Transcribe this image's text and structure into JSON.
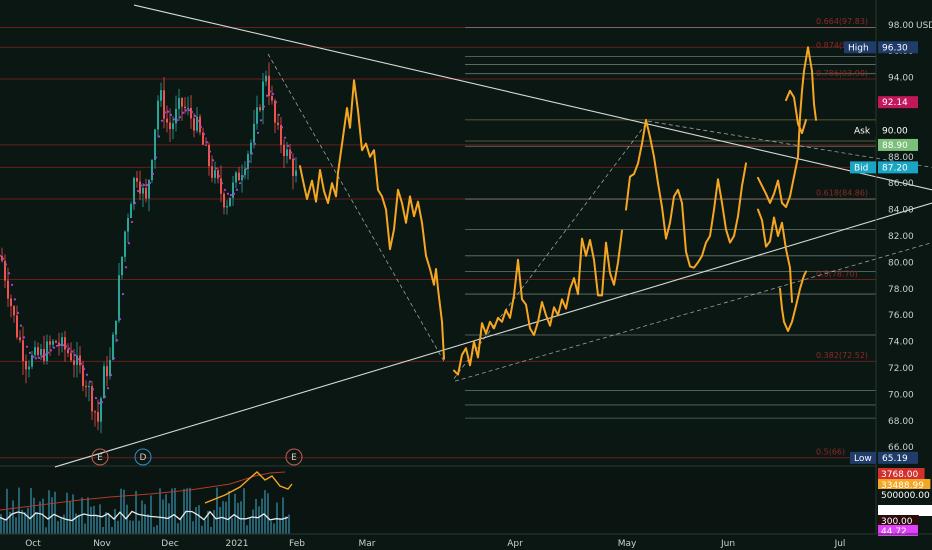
{
  "chart_data": {
    "type": "line",
    "currency": "USD",
    "y_axis_ticks": [
      98,
      96,
      94,
      92,
      90,
      88,
      86,
      84,
      82,
      80,
      78,
      76,
      74,
      72,
      70,
      68,
      66
    ],
    "x_axis_ticks": [
      "Oct",
      "Nov",
      "Dec",
      "2021",
      "Feb",
      "Mar",
      "Apr",
      "May",
      "Jun",
      "Jul"
    ],
    "ylim": [
      64.8,
      99.2
    ],
    "price_tags": [
      {
        "label": "High",
        "value": "96.30",
        "color": "#1f3c6b"
      },
      {
        "label": "",
        "value": "92.14",
        "color": "#c2185b"
      },
      {
        "label": "Ask",
        "value": "90.00",
        "color": "#0b1712"
      },
      {
        "label": "",
        "value": "88.90",
        "color": "#7bbf7b"
      },
      {
        "label": "Bid",
        "value": "87.20",
        "color": "#1aa5c4"
      },
      {
        "label": "Low",
        "value": "65.19",
        "color": "#1f3c6b"
      }
    ],
    "fib_labels": [
      {
        "text": "0.664(97.83)",
        "price": 97.83
      },
      {
        "text": "0.874(95.72)",
        "price": 96.0
      },
      {
        "text": "0.786(93.90)",
        "price": 93.9
      },
      {
        "text": "0.618(84.86)",
        "price": 84.86
      },
      {
        "text": "0.5(78.70)",
        "price": 78.7
      },
      {
        "text": "0.382(72.52)",
        "price": 72.52
      },
      {
        "text": "0.5(66)",
        "price": 65.2
      }
    ],
    "horizontal_levels": [
      97.8,
      96.3,
      93.9,
      88.9,
      87.2,
      84.8,
      78.7,
      72.5,
      65.2
    ],
    "projection_segments": [
      [
        [
          300,
          87.3
        ],
        [
          303,
          86.2
        ],
        [
          307,
          84.8
        ],
        [
          312,
          86.2
        ],
        [
          316,
          84.6
        ],
        [
          320,
          87.0
        ],
        [
          324,
          85.4
        ],
        [
          328,
          84.5
        ],
        [
          332,
          86.0
        ],
        [
          336,
          85.0
        ],
        [
          338,
          86.8
        ],
        [
          343,
          89.5
        ],
        [
          347,
          91.7
        ],
        [
          350,
          90.2
        ],
        [
          354,
          93.8
        ],
        [
          358,
          91.5
        ],
        [
          362,
          88.5
        ],
        [
          366,
          89.0
        ],
        [
          370,
          88.0
        ],
        [
          374,
          88.5
        ],
        [
          378,
          85.5
        ],
        [
          382,
          85.0
        ],
        [
          386,
          84.0
        ],
        [
          390,
          81.0
        ],
        [
          394,
          82.5
        ],
        [
          398,
          85.5
        ],
        [
          402,
          84.5
        ],
        [
          406,
          83.0
        ],
        [
          410,
          85.0
        ],
        [
          414,
          83.5
        ],
        [
          418,
          84.6
        ],
        [
          422,
          83.0
        ],
        [
          426,
          80.5
        ],
        [
          430,
          79.5
        ],
        [
          434,
          78.3
        ],
        [
          436,
          79.5
        ],
        [
          438,
          78.0
        ],
        [
          442,
          75.5
        ],
        [
          444,
          72.7
        ]
      ],
      [
        [
          454,
          71.8
        ],
        [
          458,
          71.5
        ],
        [
          462,
          73.0
        ],
        [
          466,
          73.5
        ],
        [
          470,
          72.2
        ],
        [
          474,
          74.0
        ],
        [
          478,
          72.8
        ],
        [
          482,
          75.4
        ],
        [
          486,
          74.6
        ],
        [
          490,
          75.5
        ],
        [
          494,
          75.0
        ],
        [
          498,
          75.8
        ],
        [
          502,
          75.5
        ],
        [
          506,
          76.4
        ],
        [
          510,
          75.8
        ],
        [
          514,
          77.5
        ],
        [
          518,
          80.2
        ],
        [
          522,
          77.2
        ],
        [
          526,
          76.8
        ],
        [
          530,
          75.0
        ],
        [
          534,
          74.5
        ],
        [
          538,
          75.5
        ],
        [
          542,
          77.0
        ],
        [
          546,
          76.0
        ],
        [
          550,
          75.2
        ],
        [
          554,
          76.6
        ],
        [
          558,
          76.0
        ],
        [
          562,
          77.2
        ],
        [
          566,
          76.5
        ],
        [
          570,
          78.0
        ],
        [
          574,
          78.8
        ],
        [
          578,
          77.6
        ],
        [
          582,
          81.8
        ],
        [
          586,
          80.5
        ],
        [
          590,
          81.7
        ],
        [
          594,
          80.2
        ],
        [
          598,
          77.5
        ],
        [
          602,
          77.5
        ],
        [
          606,
          81.5
        ],
        [
          610,
          79.2
        ],
        [
          614,
          78.3
        ],
        [
          618,
          80.0
        ],
        [
          622,
          82.4
        ]
      ],
      [
        [
          626,
          84.0
        ],
        [
          630,
          86.5
        ],
        [
          634,
          86.7
        ],
        [
          638,
          87.5
        ],
        [
          642,
          89.0
        ],
        [
          646,
          90.8
        ],
        [
          650,
          89.5
        ],
        [
          654,
          88.0
        ],
        [
          658,
          86.0
        ],
        [
          662,
          84.2
        ],
        [
          666,
          81.8
        ],
        [
          670,
          83.0
        ],
        [
          674,
          85.0
        ],
        [
          678,
          85.5
        ],
        [
          682,
          84.5
        ],
        [
          686,
          80.8
        ],
        [
          690,
          79.7
        ],
        [
          694,
          79.6
        ],
        [
          698,
          80.0
        ],
        [
          702,
          80.5
        ],
        [
          706,
          81.5
        ],
        [
          710,
          82.0
        ],
        [
          714,
          84.0
        ],
        [
          718,
          86.3
        ],
        [
          722,
          84.5
        ],
        [
          726,
          82.5
        ],
        [
          730,
          81.5
        ],
        [
          734,
          82.0
        ],
        [
          738,
          83.5
        ],
        [
          742,
          85.8
        ],
        [
          746,
          87.5
        ]
      ],
      [
        [
          758,
          84.0
        ],
        [
          762,
          83.2
        ],
        [
          766,
          81.2
        ],
        [
          770,
          81.6
        ],
        [
          774,
          83.4
        ],
        [
          778,
          82.0
        ],
        [
          782,
          83.0
        ],
        [
          786,
          81.0
        ],
        [
          790,
          79.6
        ],
        [
          792,
          77.0
        ]
      ],
      [
        [
          758,
          86.4
        ],
        [
          762,
          85.8
        ],
        [
          766,
          85.2
        ],
        [
          770,
          84.5
        ],
        [
          774,
          85.2
        ],
        [
          778,
          86.2
        ],
        [
          782,
          84.5
        ],
        [
          786,
          84.2
        ],
        [
          790,
          85.0
        ],
        [
          794,
          86.5
        ],
        [
          798,
          88.0
        ],
        [
          800,
          91.0
        ],
        [
          802,
          93.0
        ],
        [
          804,
          94.5
        ],
        [
          808,
          96.3
        ],
        [
          812,
          94.5
        ],
        [
          814,
          92.0
        ],
        [
          816,
          90.8
        ]
      ],
      [
        [
          780,
          78.0
        ],
        [
          782,
          76.5
        ],
        [
          784,
          75.5
        ],
        [
          788,
          74.8
        ],
        [
          792,
          75.5
        ],
        [
          796,
          76.7
        ],
        [
          800,
          78.0
        ],
        [
          804,
          79.0
        ],
        [
          806,
          79.3
        ]
      ],
      [
        [
          786,
          92.3
        ],
        [
          790,
          93.0
        ],
        [
          794,
          92.5
        ],
        [
          798,
          90.5
        ],
        [
          802,
          89.8
        ],
        [
          806,
          90.8
        ]
      ]
    ],
    "trend_lines": [
      {
        "name": "",
        "from": [
          134,
          99.5
        ],
        "to": [
          932,
          85.5
        ],
        "style": "solid"
      },
      {
        "name": "",
        "from": [
          55,
          64.5
        ],
        "to": [
          932,
          84.5
        ],
        "style": "solid"
      },
      {
        "name": "",
        "from": [
          455,
          71.0
        ],
        "to": [
          932,
          81.5
        ],
        "style": "dashed"
      },
      {
        "name": "",
        "from": [
          268,
          95.8
        ],
        "to": [
          444,
          72.5
        ],
        "style": "dashed"
      },
      {
        "name": "",
        "from": [
          454,
          71.2
        ],
        "to": [
          648,
          90.7
        ],
        "style": "dashed"
      },
      {
        "name": "",
        "from": [
          648,
          90.7
        ],
        "to": [
          932,
          87.2
        ],
        "style": "dashed"
      }
    ],
    "events": [
      {
        "label": "E",
        "color": "#c75b56"
      },
      {
        "label": "D",
        "color": "#2f8fcf"
      },
      {
        "label": "E",
        "color": "#c75b56"
      }
    ],
    "volume_panel": {
      "tags": [
        {
          "value": "3768.00",
          "color": "#d32f2f"
        },
        {
          "value": "33488.99",
          "color": "#f5a623"
        },
        {
          "value": "500000.00",
          "color": "#0b1712"
        },
        {
          "value": "166883.43",
          "color": "#ffffff"
        },
        {
          "value": "300.00",
          "color": "#2a0a0a"
        },
        {
          "value": "44.72",
          "color": "#e040fb"
        }
      ]
    }
  },
  "colors": {
    "background": "#0b1712",
    "projection": "#f5a623",
    "up_candle": "#26a69a",
    "down_candle": "#ef5350",
    "moving_average": "#b040d8",
    "fib_line": "#7a1f1f",
    "level_line": "#c9d1cf"
  }
}
